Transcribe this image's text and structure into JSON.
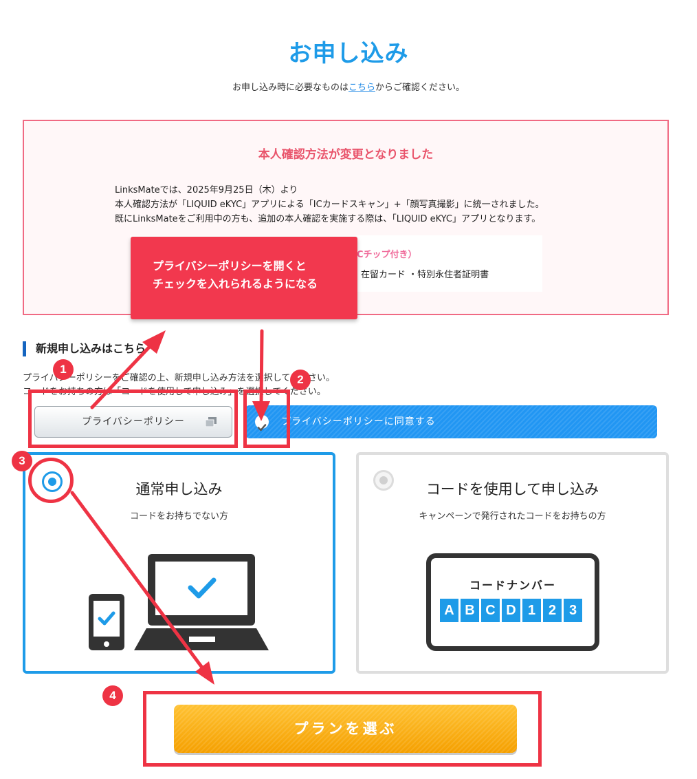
{
  "header": {
    "title": "お申し込み",
    "subtitle_before": "お申し込み時に必要なものは",
    "subtitle_link": "こちら",
    "subtitle_after": "からご確認ください。"
  },
  "notice": {
    "title": "本人確認方法が変更となりました",
    "lines": [
      "LinksMateでは、2025年9月25日（木）より",
      "本人確認方法が「LIQUID eKYC」アプリによる「ICカードスキャン」+「顔写真撮影」に統一されました。",
      "既にLinksMateをご利用中の方も、追加の本人確認を実施する際は、「LIQUID eKYC」アプリとなります。"
    ],
    "card_title_visible": "Cチップ付き）",
    "card_items_visible": "在留カード ・特別永住者証明書"
  },
  "callout": {
    "line1": "プライバシーポリシーを開くと",
    "line2": "チェックを入れられるようになる"
  },
  "signup": {
    "heading": "新規申し込みはこちら",
    "instruction_1": "プライバシーポリシーをご確認の上、新規申し込み方法を選択してください。",
    "instruction_2": "コードをお持ちの方は「コードを使用して申し込み」を選択してください。",
    "policy_button": "プライバシーポリシー",
    "agree_label": "プライバシーポリシーに同意する"
  },
  "plans": {
    "normal": {
      "name": "通常申し込み",
      "desc": "コードをお持ちでない方",
      "selected": true
    },
    "code": {
      "name": "コードを使用して申し込み",
      "desc": "キャンペーンで発行されたコードをお持ちの方",
      "selected": false,
      "code_label": "コードナンバー",
      "code_chars": [
        "A",
        "B",
        "C",
        "D",
        "1",
        "2",
        "3"
      ]
    }
  },
  "cta": {
    "label": "プランを選ぶ"
  },
  "annotations": {
    "badges": [
      "1",
      "2",
      "3",
      "4"
    ],
    "accent_color": "#ee3344"
  },
  "colors": {
    "primary": "#1e9be8",
    "notice_pink": "#e9546b",
    "cta_orange": "#f5a300"
  }
}
